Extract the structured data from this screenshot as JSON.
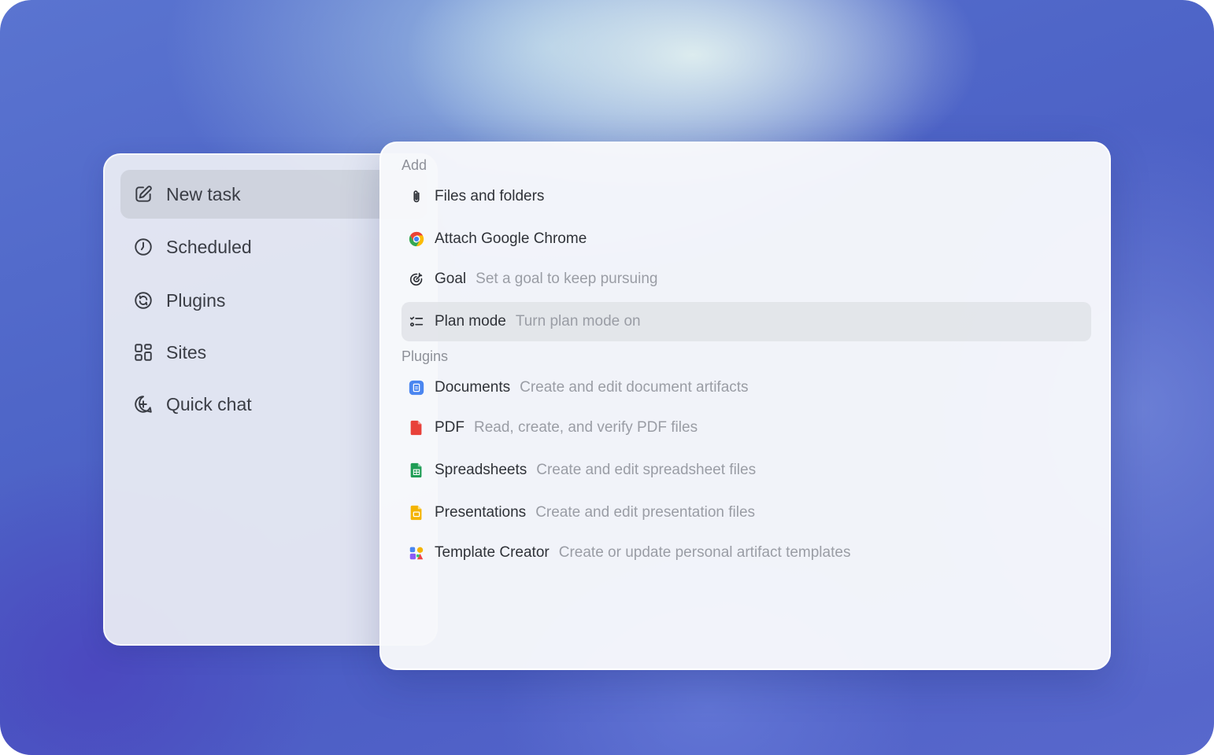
{
  "sidebar": {
    "items": [
      {
        "label": "New task",
        "icon": "edit-icon",
        "active": true
      },
      {
        "label": "Scheduled",
        "icon": "clock-icon"
      },
      {
        "label": "Plugins",
        "icon": "plugins-icon"
      },
      {
        "label": "Sites",
        "icon": "grid-icon"
      },
      {
        "label": "Quick chat",
        "icon": "chat-plus-icon"
      }
    ]
  },
  "popup": {
    "add_section": {
      "label": "Add",
      "items": [
        {
          "title": "Files and folders",
          "desc": "",
          "icon": "paperclip-icon"
        },
        {
          "title": "Attach Google Chrome",
          "desc": "",
          "icon": "chrome-icon"
        },
        {
          "title": "Goal",
          "desc": "Set a goal to keep pursuing",
          "icon": "target-icon"
        },
        {
          "title": "Plan mode",
          "desc": "Turn plan mode on",
          "icon": "checklist-icon",
          "hovered": true
        }
      ]
    },
    "plugins_section": {
      "label": "Plugins",
      "items": [
        {
          "title": "Documents",
          "desc": "Create and edit document artifacts",
          "icon": "documents-icon"
        },
        {
          "title": "PDF",
          "desc": "Read, create, and verify PDF files",
          "icon": "pdf-icon"
        },
        {
          "title": "Spreadsheets",
          "desc": "Create and edit spreadsheet files",
          "icon": "spreadsheet-icon"
        },
        {
          "title": "Presentations",
          "desc": "Create and edit presentation files",
          "icon": "presentation-icon"
        },
        {
          "title": "Template Creator",
          "desc": "Create or update personal artifact templates",
          "icon": "template-icon"
        }
      ]
    }
  },
  "colors": {
    "documents_blue": "#4a86f0",
    "pdf_red": "#e8423a",
    "sheets_green": "#1f9d55",
    "slides_yellow": "#f4b400"
  }
}
